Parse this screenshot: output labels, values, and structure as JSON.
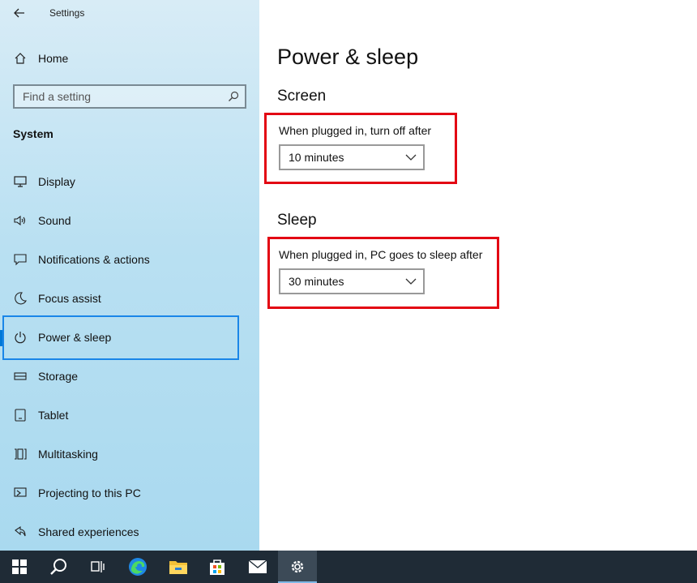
{
  "window": {
    "title": "Settings"
  },
  "sidebar": {
    "home_label": "Home",
    "search": {
      "placeholder": "Find a setting"
    },
    "section_title": "System",
    "items": [
      {
        "label": "Display",
        "icon": "monitor-icon"
      },
      {
        "label": "Sound",
        "icon": "speaker-icon"
      },
      {
        "label": "Notifications & actions",
        "icon": "notification-icon"
      },
      {
        "label": "Focus assist",
        "icon": "moon-icon"
      },
      {
        "label": "Power & sleep",
        "icon": "power-icon",
        "selected": true
      },
      {
        "label": "Storage",
        "icon": "storage-icon"
      },
      {
        "label": "Tablet",
        "icon": "tablet-icon"
      },
      {
        "label": "Multitasking",
        "icon": "multitasking-icon"
      },
      {
        "label": "Projecting to this PC",
        "icon": "projecting-icon"
      },
      {
        "label": "Shared experiences",
        "icon": "shared-icon"
      }
    ]
  },
  "main": {
    "title": "Power & sleep",
    "screen": {
      "heading": "Screen",
      "label": "When plugged in, turn off after",
      "value": "10 minutes"
    },
    "sleep": {
      "heading": "Sleep",
      "label": "When plugged in, PC goes to sleep after",
      "value": "30 minutes"
    }
  },
  "taskbar": {
    "items": [
      "windows-start-icon",
      "search-icon",
      "task-view-icon",
      "edge-icon",
      "file-explorer-icon",
      "store-icon",
      "mail-icon",
      "settings-gear-icon"
    ],
    "active": "settings-gear-icon"
  },
  "colors": {
    "accent": "#0078d7",
    "highlight_box": "#e30613",
    "focus_ring": "#1a86e8",
    "taskbar": "#1f2b36"
  }
}
